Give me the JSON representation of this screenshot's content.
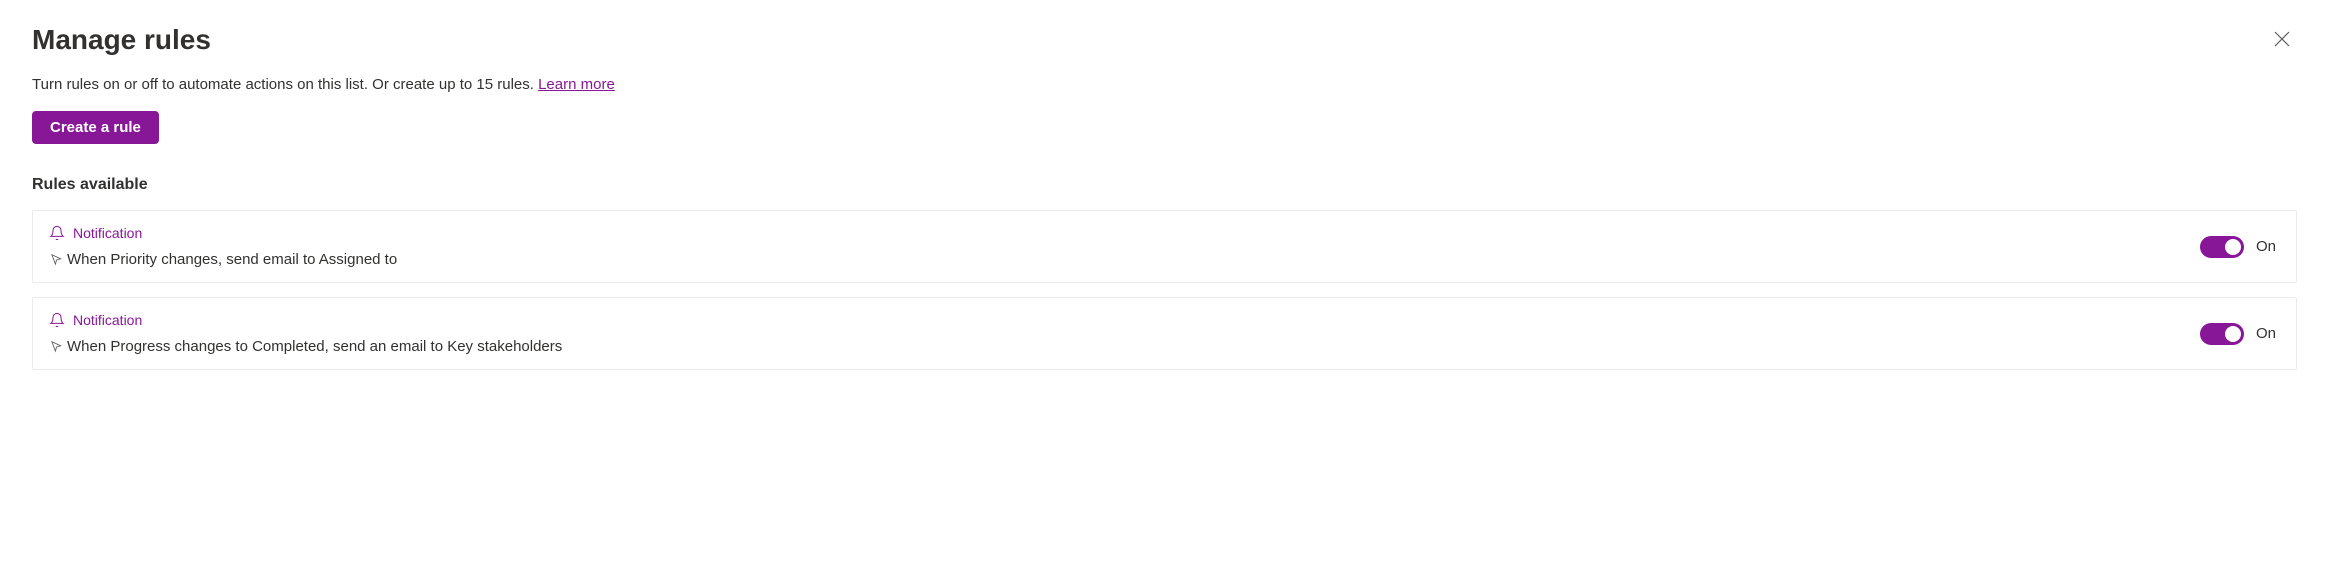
{
  "header": {
    "title": "Manage rules",
    "description": "Turn rules on or off to automate actions on this list. Or create up to 15 rules. ",
    "learn_more": "Learn more"
  },
  "buttons": {
    "create_rule": "Create a rule"
  },
  "section": {
    "heading": "Rules available"
  },
  "rules": [
    {
      "type_label": "Notification",
      "description": "When Priority changes, send email to Assigned to",
      "toggle_state": "On"
    },
    {
      "type_label": "Notification",
      "description": "When Progress changes to Completed, send an email to Key stakeholders",
      "toggle_state": "On"
    }
  ]
}
